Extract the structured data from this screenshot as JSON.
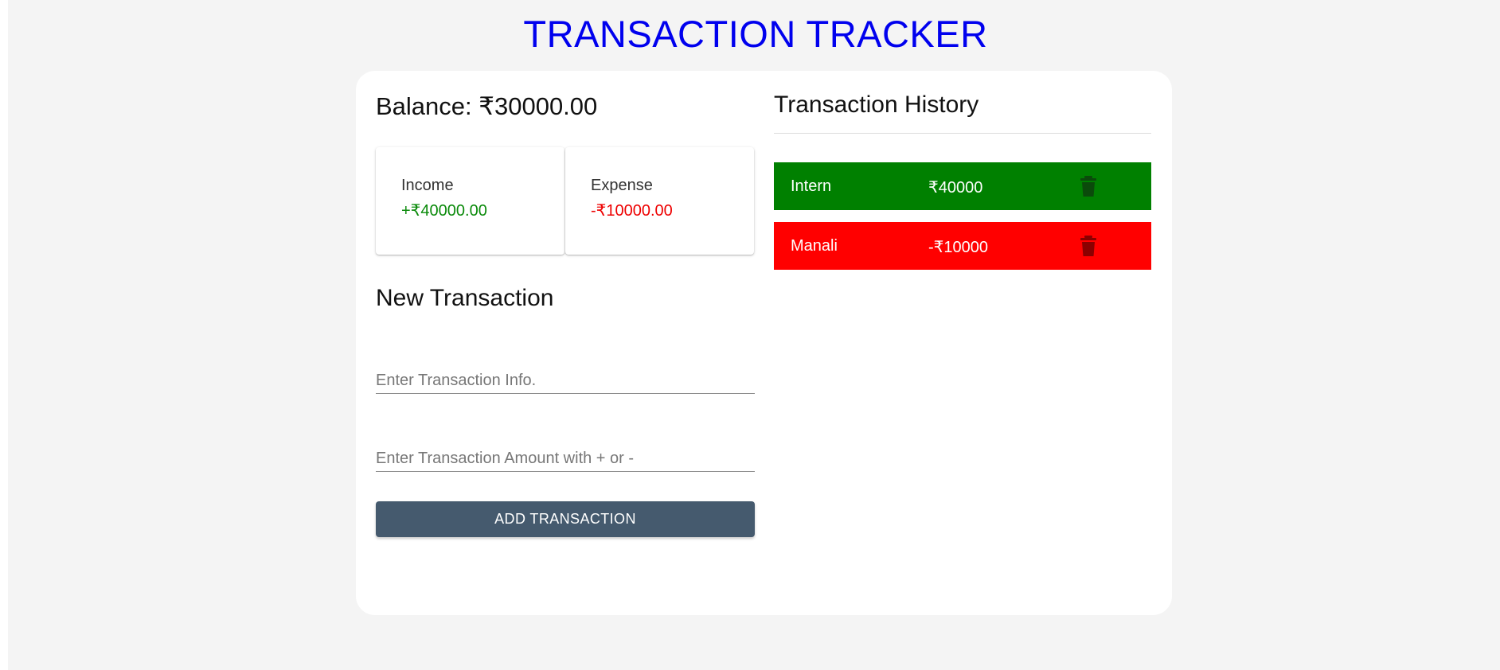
{
  "header": {
    "title": "TRANSACTION TRACKER"
  },
  "balance": {
    "text": "Balance: ₹30000.00"
  },
  "summary": {
    "income_label": "Income",
    "income_value": "+₹40000.00",
    "expense_label": "Expense",
    "expense_value": "-₹10000.00"
  },
  "form": {
    "title": "New Transaction",
    "info_placeholder": "Enter Transaction Info.",
    "info_value": "",
    "amount_placeholder": "Enter Transaction Amount with + or -",
    "amount_value": "",
    "submit_label": "ADD TRANSACTION"
  },
  "history": {
    "title": "Transaction History",
    "items": [
      {
        "name": "Intern",
        "amount": "₹40000",
        "type": "income",
        "icon": "trash-icon"
      },
      {
        "name": "Manali",
        "amount": "-₹10000",
        "type": "expense",
        "icon": "trash-icon"
      }
    ]
  },
  "colors": {
    "title": "#0000ee",
    "income": "#008000",
    "expense": "#ff0000",
    "button": "#455a6e",
    "background": "#f4f4f4"
  }
}
